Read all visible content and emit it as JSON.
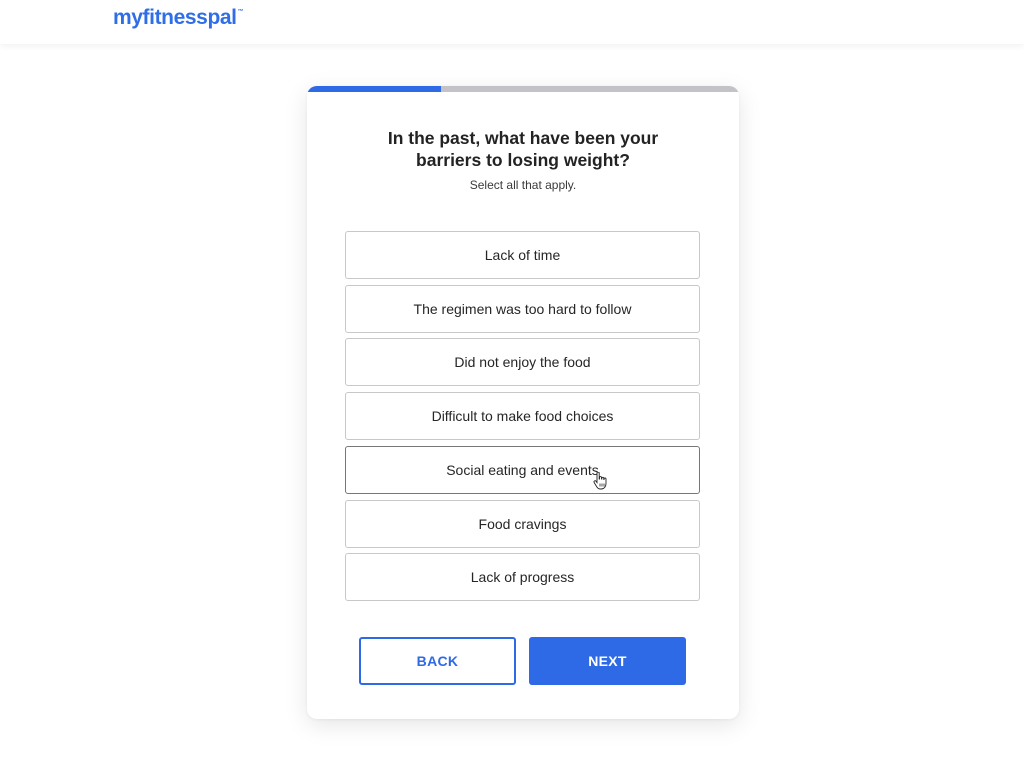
{
  "header": {
    "logo_text": "myfitnesspal",
    "logo_mark": "™",
    "brand_color": "#2e6ae6"
  },
  "progress": {
    "fraction": 0.31,
    "fill_color": "#2e6ae6",
    "track_color": "#c2c2c7"
  },
  "question": {
    "title_line1": "In the past, what have been your",
    "title_line2": "barriers to losing weight?",
    "subtitle": "Select all that apply."
  },
  "options": [
    {
      "label": "Lack of time",
      "hovered": false
    },
    {
      "label": "The regimen was too hard to follow",
      "hovered": false
    },
    {
      "label": "Did not enjoy the food",
      "hovered": false
    },
    {
      "label": "Difficult to make food choices",
      "hovered": false
    },
    {
      "label": "Social eating and events",
      "hovered": true
    },
    {
      "label": "Food cravings",
      "hovered": false
    },
    {
      "label": "Lack of progress",
      "hovered": false
    }
  ],
  "buttons": {
    "back_label": "BACK",
    "next_label": "NEXT"
  },
  "cursor": {
    "icon": "hand-pointer-icon"
  }
}
